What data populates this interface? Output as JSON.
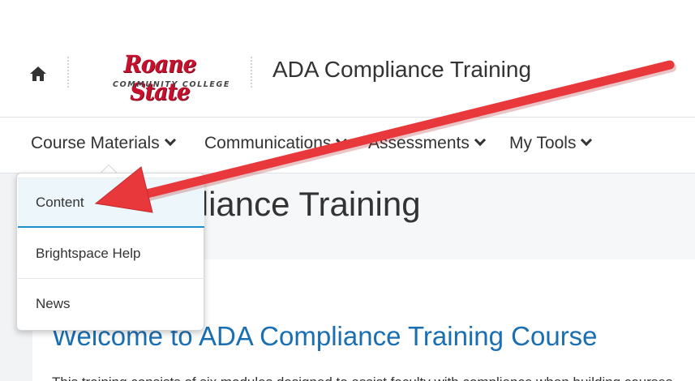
{
  "header": {
    "home_icon": "home-icon",
    "logo": {
      "name": "Roane State",
      "subtitle": "COMMUNITY COLLEGE"
    },
    "course_title": "ADA Compliance Training"
  },
  "nav": {
    "items": [
      {
        "label": "Course Materials",
        "icon": "chevron-down-icon"
      },
      {
        "label": "Communications",
        "icon": "chevron-down-icon"
      },
      {
        "label": "Assessments",
        "icon": "chevron-down-icon"
      },
      {
        "label": "My Tools",
        "icon": "chevron-down-icon"
      }
    ]
  },
  "dropdown": {
    "items": [
      {
        "label": "Content"
      },
      {
        "label": "Brightspace Help"
      },
      {
        "label": "News"
      }
    ]
  },
  "page": {
    "hero_title": "ADA Compliance Training",
    "welcome_heading": "Welcome to ADA Compliance Training Course",
    "body_text": "This training consists of six modules designed to assist faculty with compliance when building courses"
  },
  "colors": {
    "accent": "#1a8fc9",
    "link": "#1a6fb3",
    "annotation_arrow": "#e8383b",
    "logo_red": "#c8102e"
  }
}
